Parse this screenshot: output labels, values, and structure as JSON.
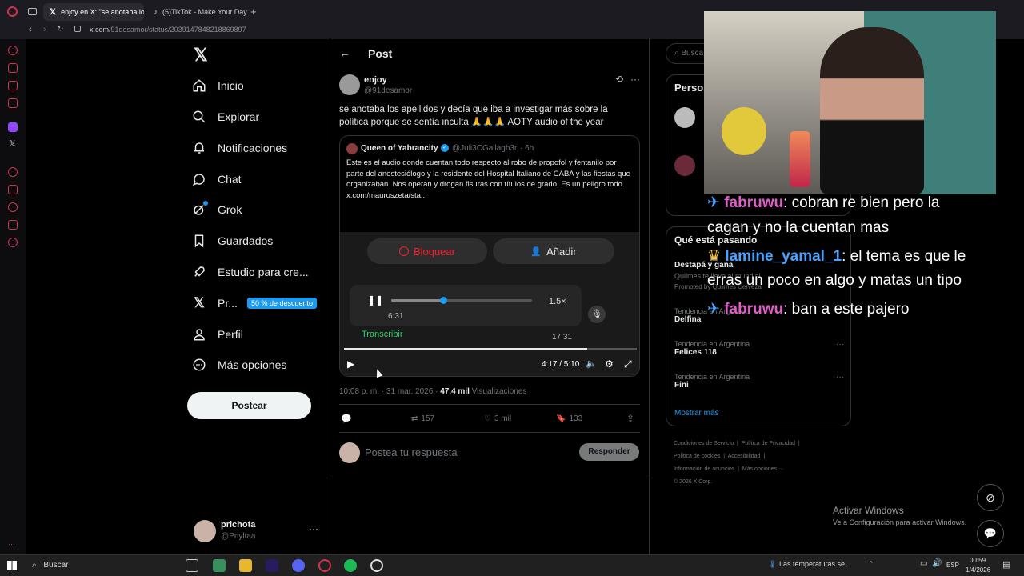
{
  "browser": {
    "tabs": [
      {
        "label": "enjoy en X: \"se anotaba lo"
      },
      {
        "label": "(5)TikTok - Make Your Day"
      }
    ],
    "url_host": "x.com",
    "url_path": "/91desamor/status/2039147848218869897"
  },
  "nav": {
    "items": [
      {
        "label": "Inicio"
      },
      {
        "label": "Explorar"
      },
      {
        "label": "Notificaciones"
      },
      {
        "label": "Chat"
      },
      {
        "label": "Grok"
      },
      {
        "label": "Guardados"
      },
      {
        "label": "Estudio para cre..."
      },
      {
        "label": "Pr..."
      },
      {
        "label": "Perfil"
      },
      {
        "label": "Más opciones"
      }
    ],
    "premium_badge": "50 % de descuento",
    "post_button": "Postear",
    "account_name": "prichota",
    "account_handle": "@Priyltaa"
  },
  "post": {
    "header_title": "Post",
    "author_name": "enjoy",
    "author_handle": "@91desamor",
    "text": "se anotaba los apellidos y decía que iba a investigar más sobre la política porque se sentía inculta 🙏🙏🙏 AOTY audio of the year",
    "quote": {
      "author_name": "Queen of Yabrancity",
      "author_handle": "@Juli3CGallagh3r",
      "time": "· 6h",
      "text": "Este es el audio donde cuentan todo respecto al robo de propofol y fentanilo por parte del anestesiólogo y la residente del Hospital Italiano de CABA y las fiestas que organizaban. Nos operan y drogan fisuras con títulos de grado. Es un peligro todo.  x.com/mauroszeta/sta..."
    },
    "video": {
      "block_label": "Bloquear",
      "add_label": "Añadir",
      "audio_elapsed": "6:31",
      "audio_speed": "1.5×",
      "transcribe_label": "Transcribir",
      "audio_total": "17:31",
      "time_display": "4:17 / 5:10",
      "progress": 0.83,
      "audio_progress": 0.37
    },
    "timestamp": "10:08 p. m. · 31 mar. 2026 ·",
    "views_count": "47,4 mil",
    "views_label": "Visualizaciones",
    "retweets": "157",
    "likes": "3 mil",
    "bookmarks": "133",
    "reply_placeholder": "Postea tu respuesta",
    "reply_button": "Responder"
  },
  "right": {
    "search_placeholder": "Busca",
    "who_to_follow_title": "Perso",
    "trending_title": "Qué está pasando",
    "promo_title": "Destapá y gana",
    "promo_sub": "Quilmes te lleva al mundial",
    "promo_by": "Promoted by Quilmes Cerveza",
    "trends": [
      {
        "category": "Tendencia en Argentina",
        "name": "Delfina"
      },
      {
        "category": "Tendencia en Argentina",
        "name": "Felices 118"
      },
      {
        "category": "Tendencia en Argentina",
        "name": "Fini"
      }
    ],
    "show_more": "Mostrar más",
    "footer": [
      "Condiciones de Servicio",
      "Política de Privacidad",
      "Política de cookies",
      "Accesibilidad",
      "Información de anuncios",
      "Más opciones ···",
      "© 2026 X Corp."
    ]
  },
  "stream_chat": [
    {
      "user": "fabruwu",
      "message": ": cobran re bien pero la"
    },
    {
      "user": "",
      "message": "cagan y no la cuentan mas"
    },
    {
      "user": "lamine_yamal_1",
      "message": ": el tema es que le"
    },
    {
      "user": "",
      "message": "erras un poco en algo y matas un tipo"
    },
    {
      "user": "fabruwu",
      "message": ": ban a este pajero"
    }
  ],
  "windows_activation": {
    "title": "Activar Windows",
    "subtitle": "Ve a Configuración para activar Windows."
  },
  "taskbar": {
    "search_label": "Buscar",
    "weather": "Las temperaturas se...",
    "language": "ESP",
    "time": "00:59",
    "date": "1/4/2026"
  },
  "colors": {
    "accent": "#1d9bf0",
    "premium_badge_bg": "#1d9bf0",
    "block_red": "#f4212e",
    "stream_user_blue": "#4aa3ff",
    "stream_user_pink": "#e05cc9"
  }
}
